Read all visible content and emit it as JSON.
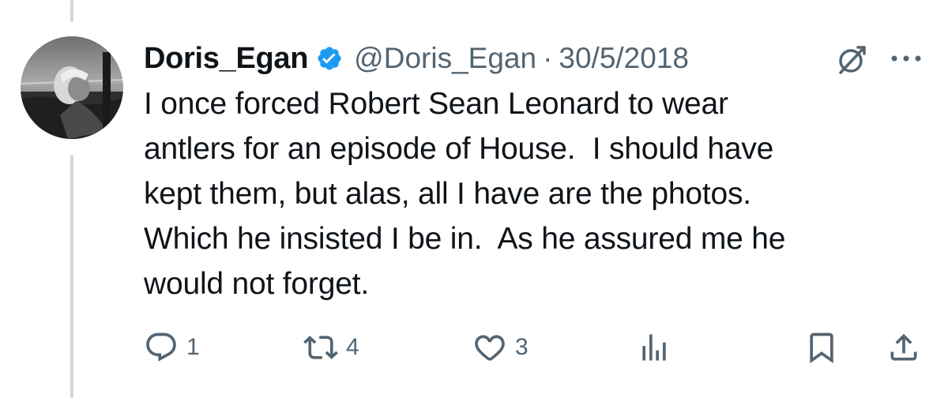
{
  "author": {
    "display_name": "Doris_Egan",
    "handle": "@Doris_Egan",
    "separator": "·",
    "date": "30/5/2018",
    "verified": true
  },
  "tweet": {
    "lines": [
      "I once forced Robert Sean Leonard to wear",
      "antlers for an episode of House.  I should have",
      "kept them, but alas, all I have are the photos.",
      "Which he insisted I be in.  As he assured me he",
      "would not forget."
    ]
  },
  "actions": {
    "reply_count": "1",
    "repost_count": "4",
    "like_count": "3"
  },
  "icons": {
    "verified": "verified-badge-icon",
    "grok": "grok-icon",
    "more": "more-icon",
    "reply": "reply-icon",
    "repost": "repost-icon",
    "like": "heart-icon",
    "views": "views-icon",
    "bookmark": "bookmark-icon",
    "share": "share-icon"
  },
  "colors": {
    "text": "#0f1419",
    "secondary": "#536471",
    "verified": "#1d9bf0",
    "thread_line": "#cfd9de"
  }
}
